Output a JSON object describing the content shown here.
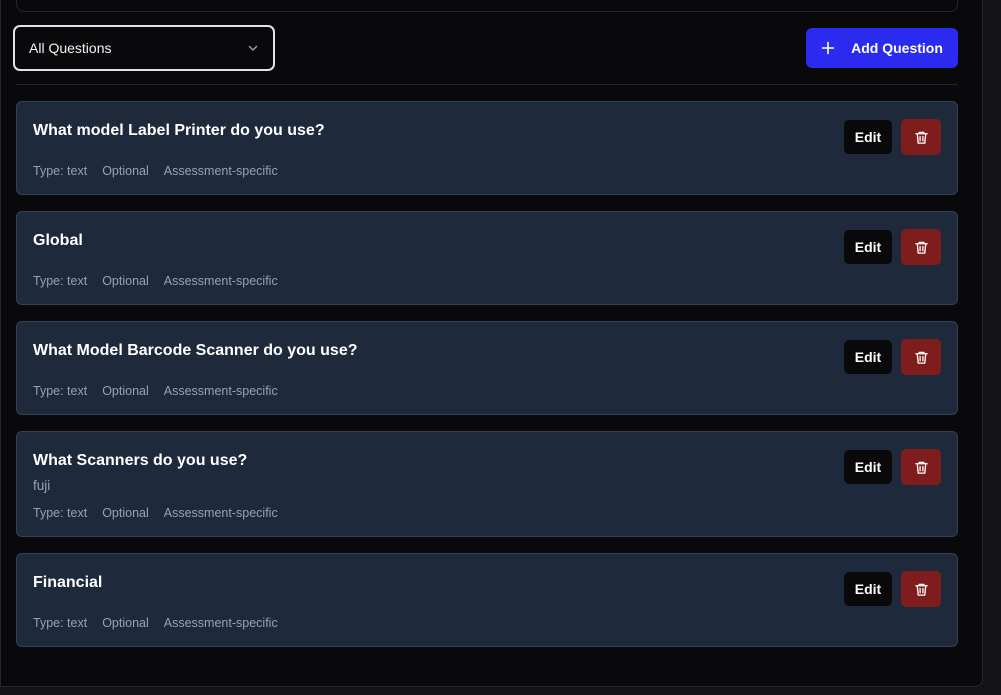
{
  "filter": {
    "selected": "All Questions",
    "icon": "chevron-down-icon"
  },
  "add_button": {
    "label": "Add Question",
    "icon": "plus-icon",
    "color": "#2b2bf0"
  },
  "questions": [
    {
      "title": "What model Label Printer do you use?",
      "description": "",
      "type": "Type: text",
      "required": "Optional",
      "scope": "Assessment-specific",
      "edit_label": "Edit"
    },
    {
      "title": "Global",
      "description": "",
      "type": "Type: text",
      "required": "Optional",
      "scope": "Assessment-specific",
      "edit_label": "Edit"
    },
    {
      "title": "What Model Barcode Scanner do you use?",
      "description": "",
      "type": "Type: text",
      "required": "Optional",
      "scope": "Assessment-specific",
      "edit_label": "Edit"
    },
    {
      "title": "What Scanners do you use?",
      "description": "fuji",
      "type": "Type: text",
      "required": "Optional",
      "scope": "Assessment-specific",
      "edit_label": "Edit"
    },
    {
      "title": "Financial",
      "description": "",
      "type": "Type: text",
      "required": "Optional",
      "scope": "Assessment-specific",
      "edit_label": "Edit"
    }
  ],
  "colors": {
    "card_bg": "#1e293b",
    "delete_bg": "#7f1d1d",
    "page_bg": "#09090b"
  }
}
